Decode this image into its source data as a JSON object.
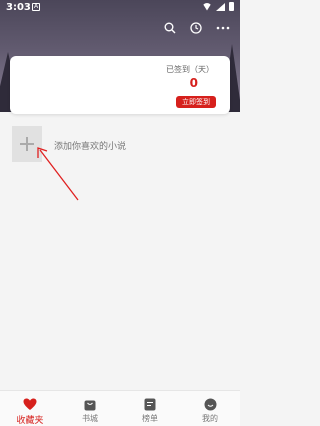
{
  "status_bar": {
    "time": "3:03",
    "notif_icon": "A"
  },
  "toolbar": {
    "icons": [
      "search-icon",
      "clock-icon",
      "more-icon"
    ]
  },
  "sign_card": {
    "label": "已签到（天）",
    "count": "0",
    "button_label": "立即签到"
  },
  "add_novel": {
    "text": "添加你喜欢的小说"
  },
  "bottom_nav": {
    "items": [
      {
        "label": "收藏夹",
        "icon": "heart-icon"
      },
      {
        "label": "书城",
        "icon": "bag-icon"
      },
      {
        "label": "榜单",
        "icon": "list-icon"
      },
      {
        "label": "我的",
        "icon": "smile-icon"
      }
    ],
    "active": "收藏夹"
  },
  "colors": {
    "accent": "#d6201c",
    "header": "#5b5568",
    "background": "#f4f4f4"
  }
}
